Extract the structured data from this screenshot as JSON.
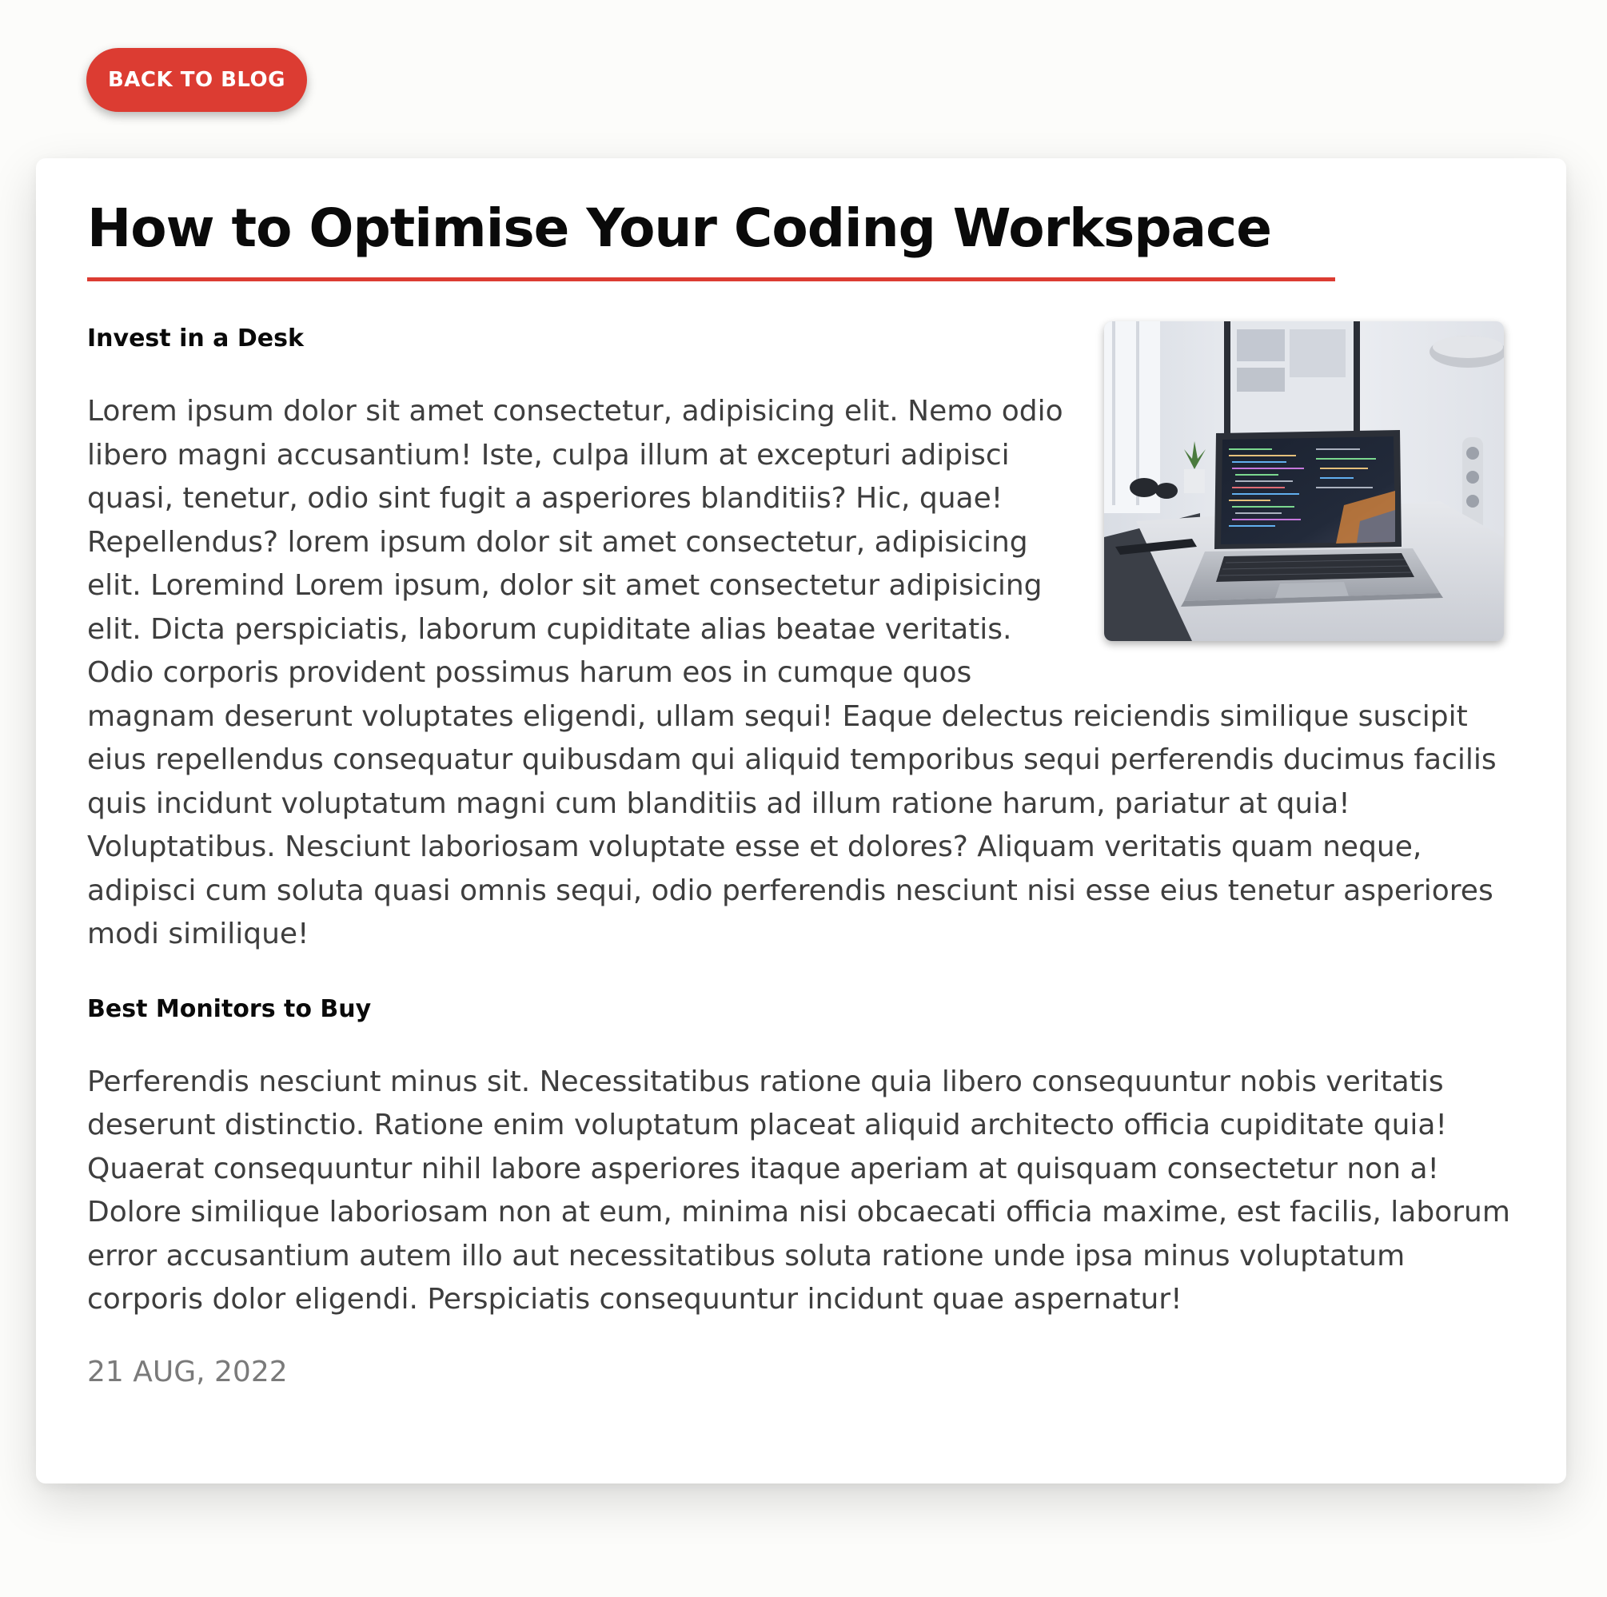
{
  "nav": {
    "back_label": "BACK TO BLOG"
  },
  "article": {
    "title": "How to Optimise Your Coding Workspace",
    "sections": [
      {
        "heading": "Invest in a Desk",
        "body": "Lorem ipsum dolor sit amet consectetur, adipisicing elit. Nemo odio libero magni accusantium! Iste, culpa illum at excepturi adipisci quasi, tenetur, odio sint fugit a asperiores blanditiis? Hic, quae! Repellendus? lorem ipsum dolor sit amet consectetur, adipisicing elit. Loremind Lorem ipsum, dolor sit amet consectetur adipisicing elit. Dicta perspiciatis, laborum cupiditate alias beatae veritatis. Odio corporis provident possimus harum eos in cumque quos magnam deserunt voluptates eligendi, ullam sequi! Eaque delectus reiciendis similique suscipit eius repellendus consequatur quibusdam qui aliquid temporibus sequi perferendis ducimus facilis quis incidunt voluptatum magni cum blanditiis ad illum ratione harum, pariatur at quia! Voluptatibus. Nesciunt laboriosam voluptate esse et dolores? Aliquam veritatis quam neque, adipisci cum soluta quasi omnis sequi, odio perferendis nesciunt nisi esse eius tenetur asperiores modi similique!"
      },
      {
        "heading": "Best Monitors to Buy",
        "body": "Perferendis nesciunt minus sit. Necessitatibus ratione quia libero consequuntur nobis veritatis deserunt distinctio. Ratione enim voluptatum placeat aliquid architecto officia cupiditate quia! Quaerat consequuntur nihil labore asperiores itaque aperiam at quisquam consectetur non a! Dolore similique laboriosam non at eum, minima nisi obcaecati officia maxime, est facilis, laborum error accusantium autem illo aut necessitatibus soluta ratione unde ipsa minus voluptatum corporis dolor eligendi. Perspiciatis consequuntur incidunt quae aspernatur!"
      }
    ],
    "date": "21 AUG, 2022"
  },
  "colors": {
    "accent": "#dc3c32",
    "page_background": "#fcfcfa",
    "card_background": "#ffffff",
    "body_text": "#3e3e3e",
    "date_text": "#7a7a7a"
  },
  "icons": {
    "photo": "laptop-desk-photo"
  }
}
